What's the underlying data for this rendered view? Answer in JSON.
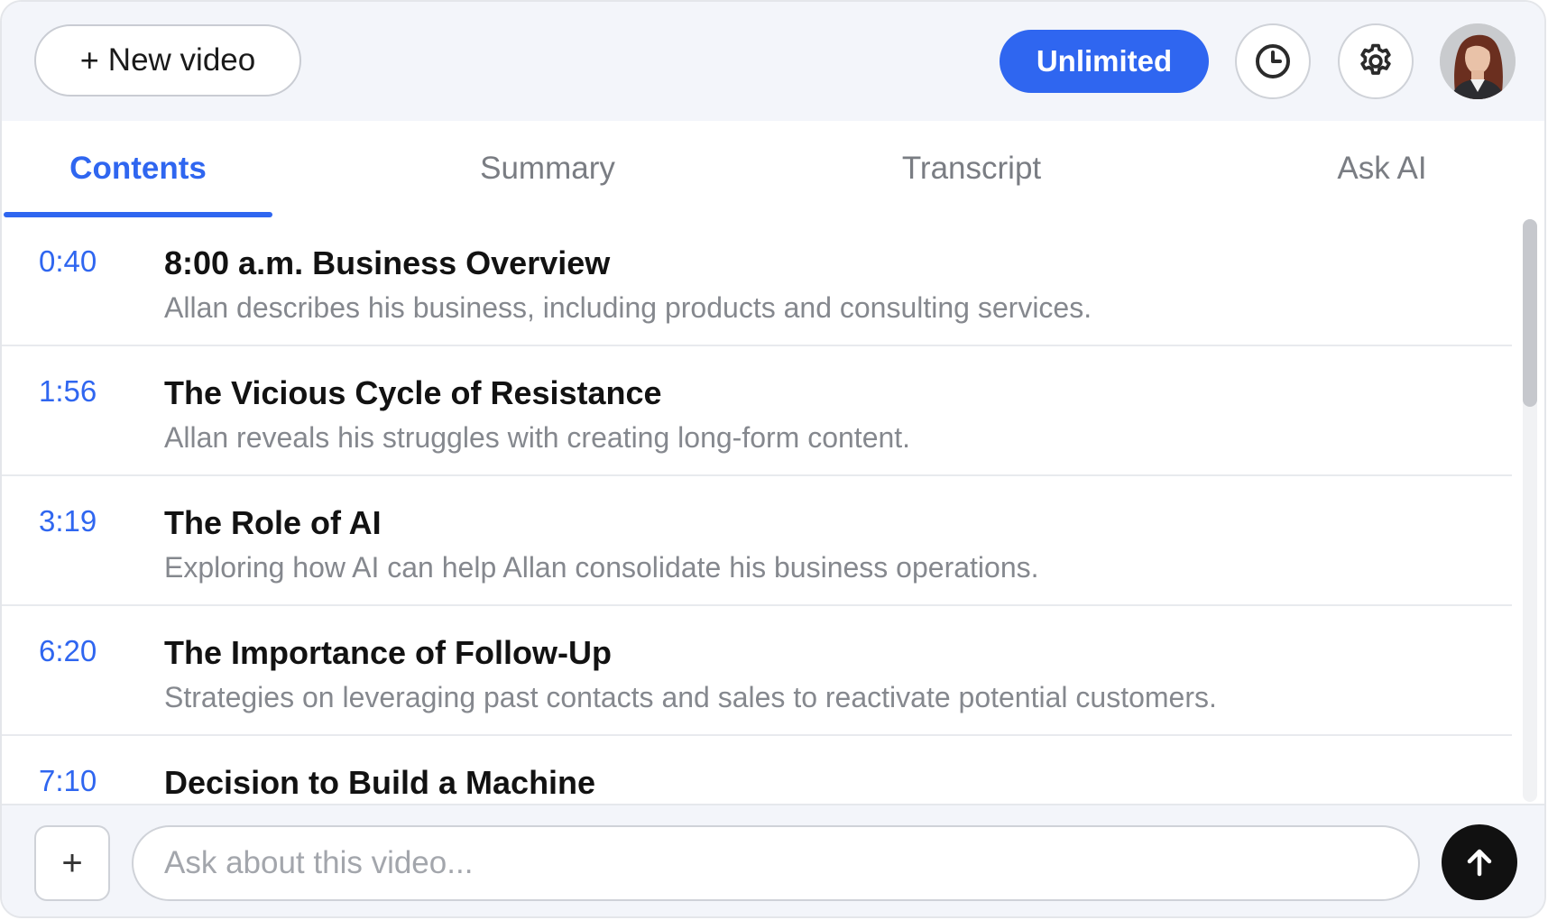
{
  "header": {
    "new_video_plus": "+",
    "new_video_label": "New video",
    "plan_label": "Unlimited",
    "history_icon": "clock-icon",
    "settings_icon": "gear-icon",
    "avatar": "user-avatar"
  },
  "colors": {
    "accent": "#2f66f0",
    "header_bg": "#f3f5fa",
    "send_button": "#111111"
  },
  "tabs": [
    {
      "label": "Contents",
      "active": true
    },
    {
      "label": "Summary",
      "active": false
    },
    {
      "label": "Transcript",
      "active": false
    },
    {
      "label": "Ask AI",
      "active": false
    }
  ],
  "contents": [
    {
      "time": "0:40",
      "title": "8:00 a.m. Business Overview",
      "description": "Allan describes his business, including products and consulting services."
    },
    {
      "time": "1:56",
      "title": "The Vicious Cycle of Resistance",
      "description": "Allan reveals his struggles with creating long-form content."
    },
    {
      "time": "3:19",
      "title": "The Role of AI",
      "description": "Exploring how AI can help Allan consolidate his business operations."
    },
    {
      "time": "6:20",
      "title": "The Importance of Follow-Up",
      "description": "Strategies on leveraging past contacts and sales to reactivate potential customers."
    },
    {
      "time": "7:10",
      "title": "Decision to Build a Machine",
      "description": ""
    }
  ],
  "footer": {
    "attach_label": "+",
    "input_placeholder": "Ask about this video...",
    "input_value": "",
    "send_icon": "arrow-up-icon"
  }
}
